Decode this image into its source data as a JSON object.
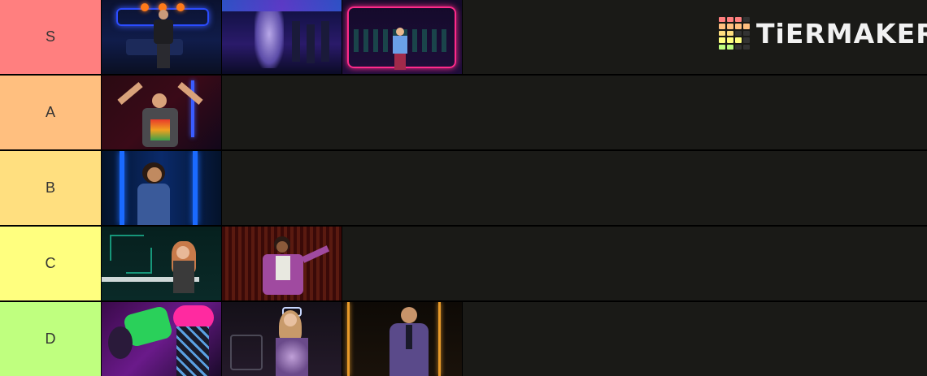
{
  "app": {
    "logo_text": "TiERMAKER"
  },
  "tiers": [
    {
      "label": "S",
      "color": "#ff7f7f",
      "items": [
        {
          "name": "tile-s-1",
          "scene": "stage-desk-blue"
        },
        {
          "name": "tile-s-2",
          "scene": "stage-ensemble-purple"
        },
        {
          "name": "tile-s-3",
          "scene": "stage-neon-frame"
        }
      ]
    },
    {
      "label": "A",
      "color": "#ffbf7f",
      "items": [
        {
          "name": "tile-a-1",
          "scene": "performer-arms-raised"
        }
      ]
    },
    {
      "label": "B",
      "color": "#ffdf7f",
      "items": [
        {
          "name": "tile-b-1",
          "scene": "performer-blue-lights"
        }
      ]
    },
    {
      "label": "C",
      "color": "#ffff7f",
      "items": [
        {
          "name": "tile-c-1",
          "scene": "performer-circuit-wall"
        },
        {
          "name": "tile-c-2",
          "scene": "performer-red-curtain"
        }
      ]
    },
    {
      "label": "D",
      "color": "#bfff7f",
      "items": [
        {
          "name": "tile-d-1",
          "scene": "dancer-pink-green"
        },
        {
          "name": "tile-d-2",
          "scene": "performer-sequin"
        },
        {
          "name": "tile-d-3",
          "scene": "performer-purple-suit"
        }
      ]
    }
  ]
}
